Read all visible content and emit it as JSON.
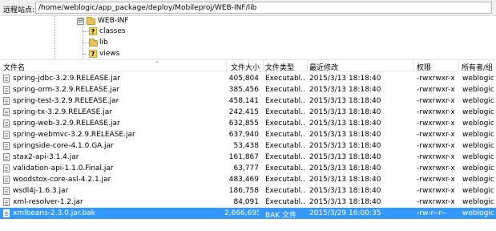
{
  "remote_site": {
    "label": "远程站点:",
    "path": "/home/weblogic/app_package/deploy/Mobileproj/WEB-INF/lib"
  },
  "tree": {
    "nodes": [
      {
        "label": "WEB-INF",
        "icon": "folder-icon",
        "expander": "⊟"
      },
      {
        "label": "classes",
        "icon": "question-folder-icon"
      },
      {
        "label": "lib",
        "icon": "folder-icon"
      },
      {
        "label": "views",
        "icon": "question-folder-icon"
      }
    ]
  },
  "columns": {
    "name": "文件名",
    "size": "文件大小",
    "type": "文件类型",
    "modified": "最近修改",
    "permissions": "权限",
    "owner": "所有者/组"
  },
  "files": [
    {
      "name": "spring-jdbc-3.2.9.RELEASE.jar",
      "size": "405,804",
      "type": "Executabl...",
      "modified": "2015/3/13 18:18:40",
      "perm": "-rwxrwxr-x",
      "owner": "weblogic ..."
    },
    {
      "name": "spring-orm-3.2.9.RELEASE.jar",
      "size": "385,456",
      "type": "Executabl...",
      "modified": "2015/3/13 18:18:40",
      "perm": "-rwxrwxr-x",
      "owner": "weblogic ..."
    },
    {
      "name": "spring-test-3.2.9.RELEASE.jar",
      "size": "458,141",
      "type": "Executabl...",
      "modified": "2015/3/13 18:18:40",
      "perm": "-rwxrwxr-x",
      "owner": "weblogic ..."
    },
    {
      "name": "spring-tx-3.2.9.RELEASE.jar",
      "size": "242,415",
      "type": "Executabl...",
      "modified": "2015/3/13 18:18:40",
      "perm": "-rwxrwxr-x",
      "owner": "weblogic ..."
    },
    {
      "name": "spring-web-3.2.9.RELEASE.jar",
      "size": "632,855",
      "type": "Executabl...",
      "modified": "2015/3/13 18:18:40",
      "perm": "-rwxrwxr-x",
      "owner": "weblogic ..."
    },
    {
      "name": "spring-webmvc-3.2.9.RELEASE.jar",
      "size": "637,940",
      "type": "Executabl...",
      "modified": "2015/3/13 18:18:40",
      "perm": "-rwxrwxr-x",
      "owner": "weblogic ..."
    },
    {
      "name": "springside-core-4.1.0.GA.jar",
      "size": "53,438",
      "type": "Executabl...",
      "modified": "2015/3/13 18:18:40",
      "perm": "-rwxrwxr-x",
      "owner": "weblogic ..."
    },
    {
      "name": "stax2-api-3.1.4.jar",
      "size": "161,867",
      "type": "Executabl...",
      "modified": "2015/3/13 18:18:40",
      "perm": "-rwxrwxr-x",
      "owner": "weblogic ..."
    },
    {
      "name": "validation-api-1.1.0.Final.jar",
      "size": "63,777",
      "type": "Executabl...",
      "modified": "2015/3/13 18:18:40",
      "perm": "-rwxrwxr-x",
      "owner": "weblogic ..."
    },
    {
      "name": "woodstox-core-asl-4.2.1.jar",
      "size": "483,469",
      "type": "Executabl...",
      "modified": "2015/3/13 18:18:40",
      "perm": "-rwxrwxr-x",
      "owner": "weblogic ..."
    },
    {
      "name": "wsdl4j-1.6.3.jar",
      "size": "186,758",
      "type": "Executabl...",
      "modified": "2015/3/13 18:18:40",
      "perm": "-rwxrwxr-x",
      "owner": "weblogic ..."
    },
    {
      "name": "xml-resolver-1.2.jar",
      "size": "84,091",
      "type": "Executabl...",
      "modified": "2015/3/13 18:18:40",
      "perm": "-rwxrwxr-x",
      "owner": "weblogic ..."
    },
    {
      "name": "xmlbeans-2.3.0.jar.bak",
      "size": "2,666,695",
      "type": "BAK 文件",
      "modified": "2015/3/29 16:00:35",
      "perm": "-rw-r--r--",
      "owner": "weblogic ...",
      "selected": true
    }
  ],
  "colors": {
    "selection": "#3399ff",
    "folder": "#e8c25b"
  }
}
